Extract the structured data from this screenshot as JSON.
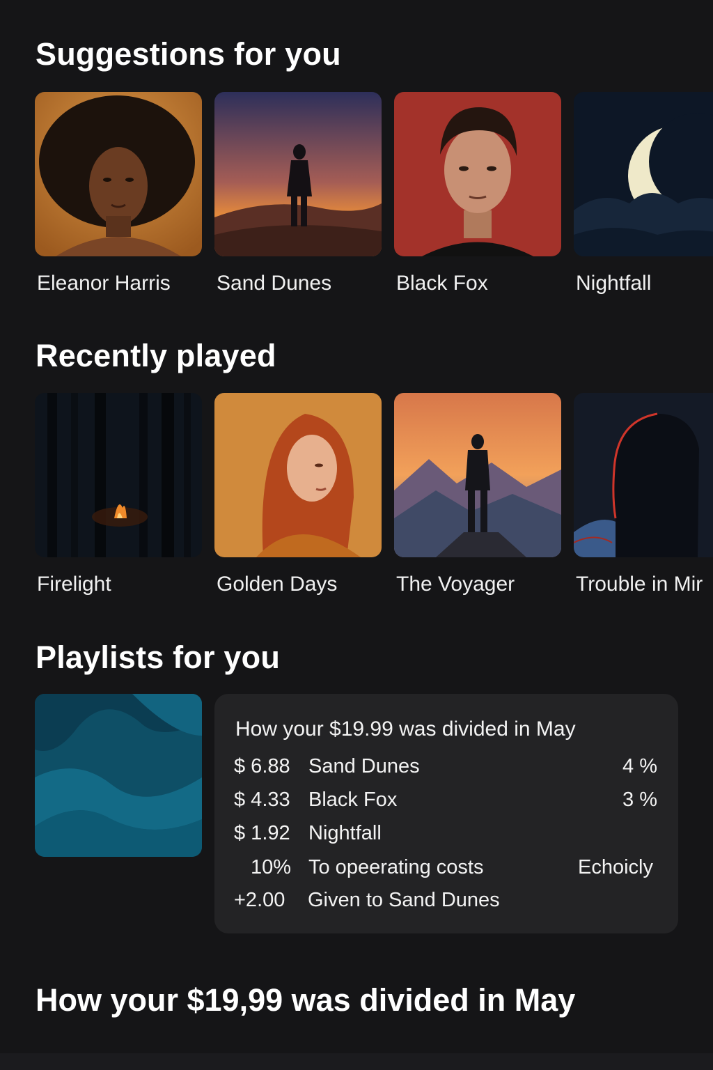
{
  "sections": {
    "suggestions_title": "Suggestions for you",
    "recent_title": "Recently played",
    "playlists_title": "Playlists for you"
  },
  "suggestions": [
    {
      "label": "Eleanor Harris",
      "icon": "portrait-woman-afro-art"
    },
    {
      "label": "Sand Dunes",
      "icon": "dunes-silhouette-art"
    },
    {
      "label": "Black Fox",
      "icon": "portrait-man-red-art"
    },
    {
      "label": "Nightfall",
      "icon": "crescent-moon-art"
    }
  ],
  "recent": [
    {
      "label": "Firelight",
      "icon": "forest-campfire-art"
    },
    {
      "label": "Golden Days",
      "icon": "portrait-redhead-art"
    },
    {
      "label": "The Voyager",
      "icon": "mountain-wanderer-art"
    },
    {
      "label": "Trouble in Mir",
      "icon": "red-silhouette-profile-art"
    }
  ],
  "breakdown": {
    "title": "How your $19.99 was divided in May",
    "rows": [
      {
        "amount": "$ 6.88",
        "name": "Sand Dunes",
        "pct": "4 %"
      },
      {
        "amount": "$ 4.33",
        "name": "Black Fox",
        "pct": "3 %"
      },
      {
        "amount": "$ 1.92",
        "name": "Nightfall",
        "pct": ""
      },
      {
        "amount": "10%",
        "name": "To opeerating costs",
        "pct": "Echoicly"
      },
      {
        "amount": "+2.00",
        "name": "Given to Sand Dunes",
        "pct": ""
      }
    ]
  },
  "footer_title": "How your $19,99 was divided in May",
  "colors": {
    "background": "#151517",
    "card_panel": "#232325",
    "playlist_teal": "#0f5a73"
  }
}
